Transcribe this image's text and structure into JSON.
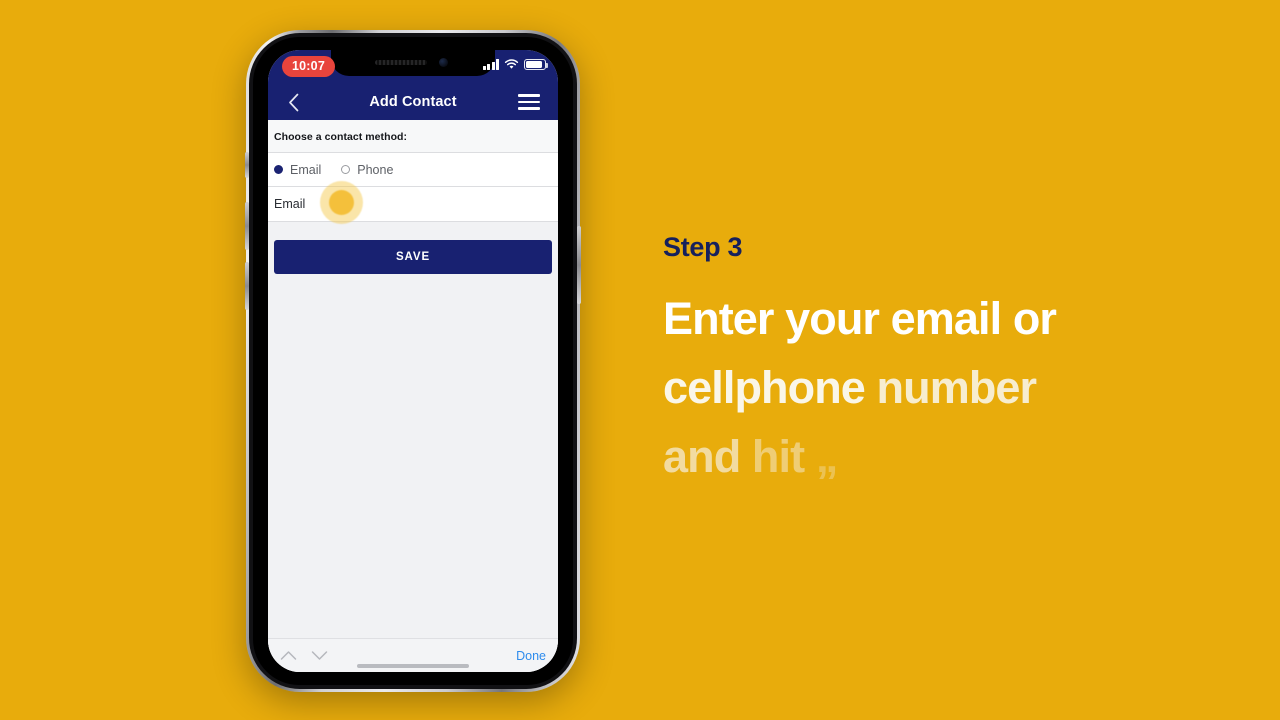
{
  "background_color": "#e8ac0c",
  "phone": {
    "status_bar": {
      "time": "10:07",
      "time_badge_color": "#e8443c",
      "signal_icon": "cellular-signal-icon",
      "wifi_icon": "wifi-icon",
      "battery_icon": "battery-icon"
    },
    "nav_bar": {
      "back_icon": "chevron-left-icon",
      "title": "Add Contact",
      "menu_icon": "hamburger-menu-icon",
      "background_color": "#182171"
    },
    "form": {
      "section_header": "Choose a contact method:",
      "radio_options": [
        {
          "label": "Email",
          "selected": true
        },
        {
          "label": "Phone",
          "selected": false
        }
      ],
      "field": {
        "label": "Email",
        "value": "",
        "placeholder": ""
      },
      "save_label": "SAVE",
      "save_color": "#182171"
    },
    "keyboard_accessory": {
      "prev_icon": "chevron-up-icon",
      "next_icon": "chevron-down-icon",
      "done_label": "Done",
      "done_color": "#2e8ced"
    },
    "touch_indicator": {
      "name": "tap-highlight",
      "color": "#f4c03b"
    }
  },
  "caption": {
    "step_label": "Step 3",
    "step_color": "#16205c",
    "lines": [
      {
        "text": "Enter your email or",
        "state": "solid"
      },
      {
        "text": "cellphone number",
        "state": "solid-fading-tail"
      },
      {
        "text": "and hit „",
        "state": "fading-out"
      }
    ],
    "line1_words": [
      "Enter",
      "your",
      "email",
      "or"
    ],
    "line2_words": [
      "cellphone",
      "number"
    ],
    "line3_words": [
      "and",
      "hit",
      "„"
    ]
  }
}
